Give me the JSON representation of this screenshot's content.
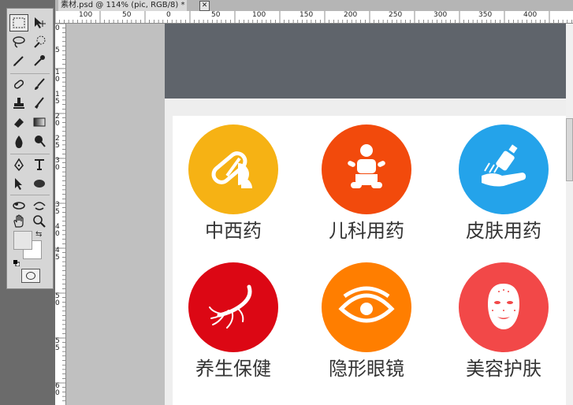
{
  "window": {
    "doc_tab_title": "素材.psd @ 114% (pic, RGB/8) *",
    "close_glyph": "✕"
  },
  "ruler": {
    "horizontal_labels": [
      "100",
      "50",
      "0",
      "50",
      "100",
      "150",
      "200",
      "250",
      "300",
      "350",
      "400"
    ],
    "vertical_labels": [
      "0",
      "5",
      "1",
      "0",
      "1",
      "5",
      "2",
      "0",
      "2",
      "5",
      "3",
      "0",
      "3",
      "5",
      "4",
      "0",
      "4",
      "5",
      "5",
      "0",
      "5",
      "5",
      "6",
      "0"
    ]
  },
  "toolbox": {
    "tools": [
      {
        "name": "marquee-tool-icon"
      },
      {
        "name": "move-tool-icon"
      },
      {
        "name": "lasso-tool-icon"
      },
      {
        "name": "quick-selection-tool-icon"
      },
      {
        "name": "crop-tool-icon"
      },
      {
        "name": "eyedropper-tool-icon"
      },
      {
        "name": "healing-brush-tool-icon"
      },
      {
        "name": "brush-tool-icon"
      },
      {
        "name": "clone-stamp-tool-icon"
      },
      {
        "name": "history-brush-tool-icon"
      },
      {
        "name": "eraser-tool-icon"
      },
      {
        "name": "gradient-tool-icon"
      },
      {
        "name": "blur-tool-icon"
      },
      {
        "name": "dodge-tool-icon"
      },
      {
        "name": "pen-tool-icon"
      },
      {
        "name": "type-tool-icon"
      },
      {
        "name": "path-selection-tool-icon"
      },
      {
        "name": "ellipse-tool-icon"
      },
      {
        "name": "3d-rotate-tool-icon"
      },
      {
        "name": "3d-orbit-tool-icon"
      },
      {
        "name": "hand-tool-icon"
      },
      {
        "name": "zoom-tool-icon"
      }
    ],
    "foreground_color": "#e6e6e6",
    "background_color": "#ffffff"
  },
  "canvas": {
    "header_color": "#5f646b",
    "categories": [
      {
        "label": "中西药",
        "color": "#f6b214",
        "icon": "pill-icon"
      },
      {
        "label": "儿科用药",
        "color": "#f24a0c",
        "icon": "baby-icon"
      },
      {
        "label": "皮肤用药",
        "color": "#24a3ea",
        "icon": "skin-cream-icon"
      },
      {
        "label": "养生保健",
        "color": "#dc0714",
        "icon": "ginseng-icon"
      },
      {
        "label": "隐形眼镜",
        "color": "#ff7e00",
        "icon": "eye-icon"
      },
      {
        "label": "美容护肤",
        "color": "#f24848",
        "icon": "face-mask-icon"
      }
    ]
  }
}
